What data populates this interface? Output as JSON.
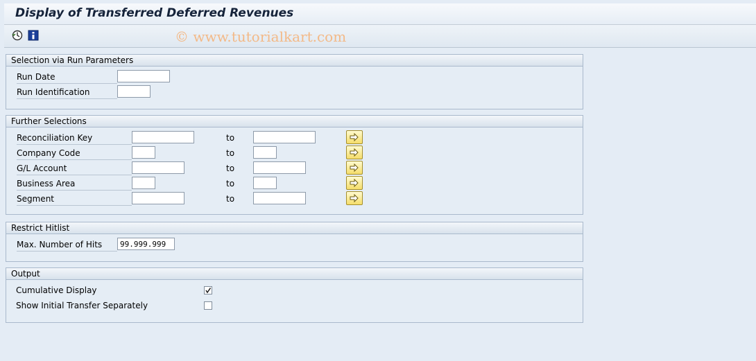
{
  "title": "Display of Transferred Deferred Revenues",
  "watermark": "© www.tutorialkart.com",
  "toolbar": {
    "execute_icon": "execute-clock-icon",
    "info_icon": "info-icon"
  },
  "run_params": {
    "title": "Selection via Run Parameters",
    "run_date_label": "Run Date",
    "run_date_value": "",
    "run_id_label": "Run Identification",
    "run_id_value": ""
  },
  "further": {
    "title": "Further Selections",
    "to_label": "to",
    "rows": [
      {
        "label": "Reconciliation Key",
        "from": "",
        "to": ""
      },
      {
        "label": "Company Code",
        "from": "",
        "to": ""
      },
      {
        "label": "G/L Account",
        "from": "",
        "to": ""
      },
      {
        "label": "Business Area",
        "from": "",
        "to": ""
      },
      {
        "label": "Segment",
        "from": "",
        "to": ""
      }
    ]
  },
  "restrict": {
    "title": "Restrict Hitlist",
    "max_hits_label": "Max. Number of Hits",
    "max_hits_value": "99.999.999"
  },
  "output": {
    "title": "Output",
    "cumulative_label": "Cumulative Display",
    "cumulative_checked": true,
    "initial_label": "Show Initial Transfer Separately",
    "initial_checked": false
  }
}
